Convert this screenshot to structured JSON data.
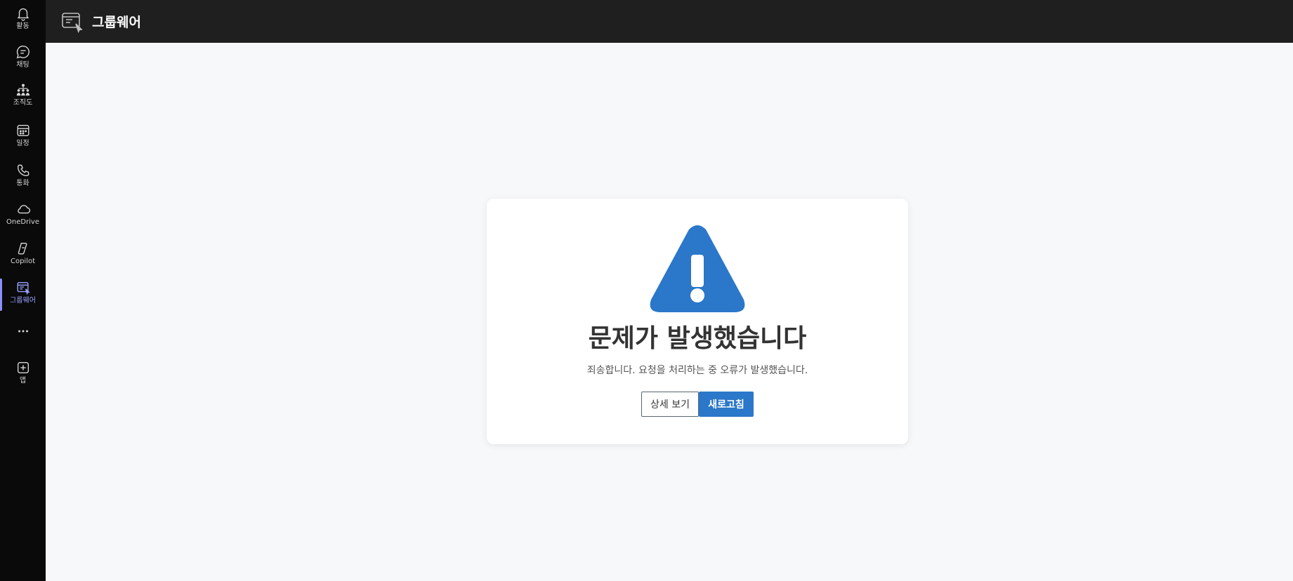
{
  "app": {
    "title": "그룹웨어"
  },
  "rail": {
    "items": [
      {
        "label": "활동",
        "icon": "bell-icon"
      },
      {
        "label": "채팅",
        "icon": "chat-icon"
      },
      {
        "label": "조직도",
        "icon": "org-chart-icon"
      },
      {
        "label": "일정",
        "icon": "calendar-icon"
      },
      {
        "label": "통화",
        "icon": "phone-icon"
      },
      {
        "label": "OneDrive",
        "icon": "cloud-icon"
      },
      {
        "label": "Copilot",
        "icon": "copilot-icon"
      },
      {
        "label": "그룹웨어",
        "icon": "groupware-icon",
        "active": true
      },
      {
        "label": "",
        "icon": "more-icon"
      },
      {
        "label": "앱",
        "icon": "add-app-icon"
      }
    ]
  },
  "error": {
    "title": "문제가 발생했습니다",
    "message": "죄송합니다. 요청을 처리하는 중 오류가 발생했습니다.",
    "details_label": "상세 보기",
    "refresh_label": "새로고침"
  },
  "colors": {
    "accent": "#2b77c9",
    "rail_active": "#9aa2ff",
    "rail_bg": "#0a0a0a",
    "topbar_bg": "#1f1f1f"
  }
}
